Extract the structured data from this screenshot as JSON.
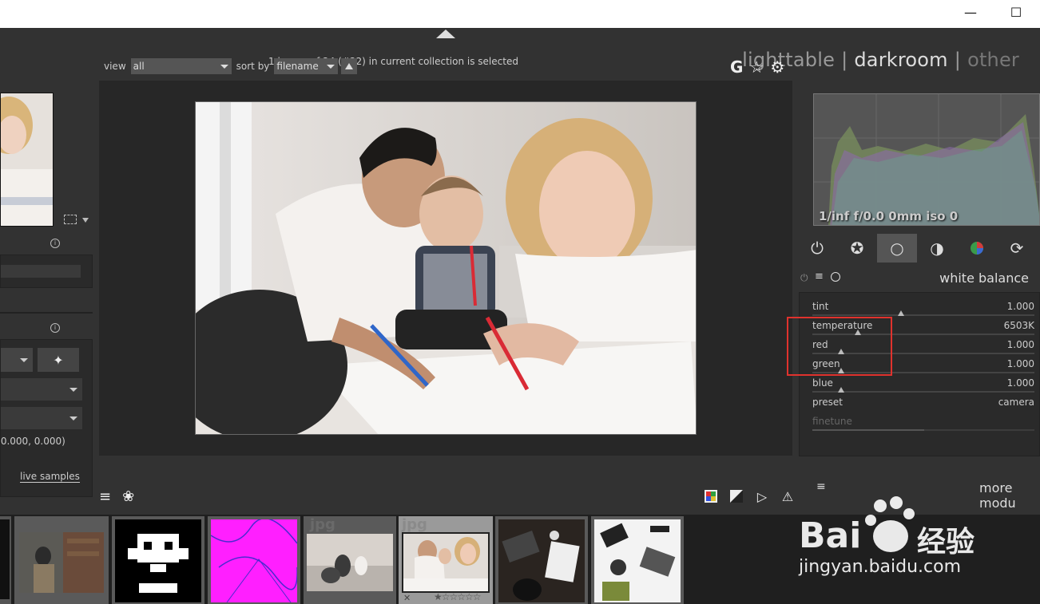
{
  "window": {
    "minimize_icon": "minimize-icon",
    "maximize_icon": "maximize-icon"
  },
  "header": {
    "selection_info": "1 image of 24 (#22) in current collection is selected",
    "views": {
      "lighttable": "lighttable",
      "separator": "|",
      "darkroom": "darkroom",
      "other": "other"
    }
  },
  "toolbar": {
    "view_label": "view",
    "view_value": "all",
    "sort_label": "sort by",
    "sort_value": "filename",
    "icons": {
      "grouping": "G"
    }
  },
  "left_panel": {
    "values_text": ".0.000, 0.000)",
    "live_samples_label": "live samples"
  },
  "right_panel": {
    "exif": "1/inf f/0.0 0mm iso 0",
    "module_title": "white balance",
    "sliders": [
      {
        "label": "tint",
        "value": "1.000"
      },
      {
        "label": "temperature",
        "value": "6503K"
      },
      {
        "label": "red",
        "value": "1.000"
      },
      {
        "label": "green",
        "value": "1.000"
      },
      {
        "label": "blue",
        "value": "1.000"
      },
      {
        "label": "preset",
        "value": "camera"
      },
      {
        "label": "finetune",
        "value": ""
      }
    ],
    "more_modules": "more modu"
  },
  "filmstrip": {
    "labels": [
      "jpg",
      "jpg"
    ]
  },
  "watermark": {
    "brand": "Bai",
    "brand_cn": "经验",
    "url": "jingyan.baidu.com"
  },
  "colors": {
    "highlight": "#e0322d",
    "accent": "#555555"
  }
}
